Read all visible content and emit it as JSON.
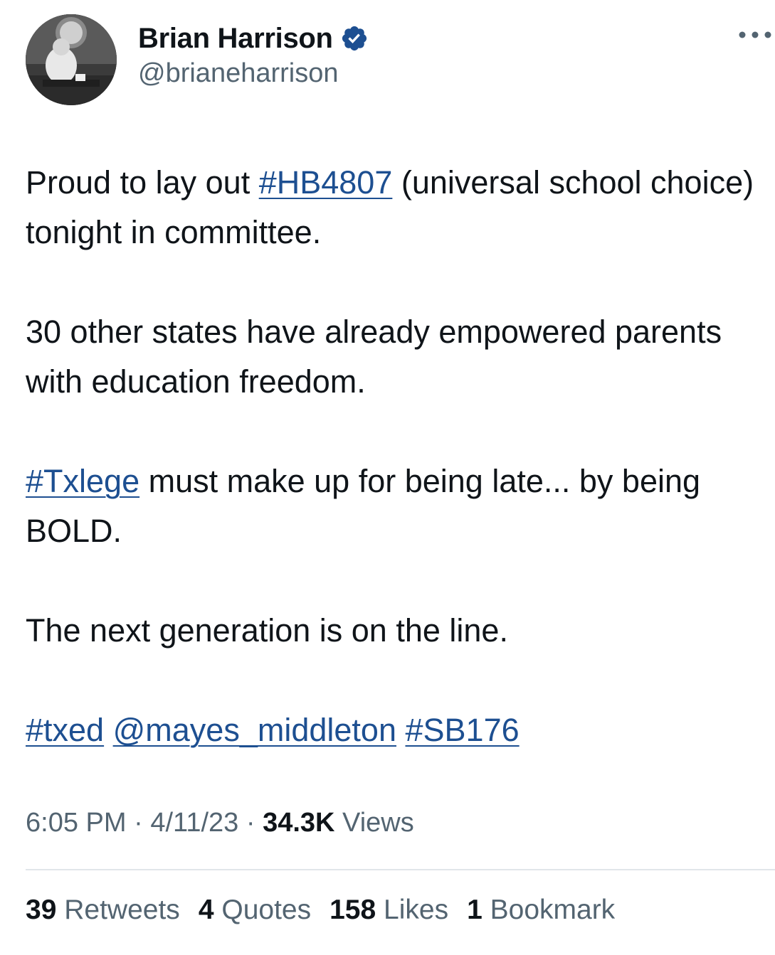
{
  "author": {
    "display_name": "Brian Harrison",
    "handle": "@brianeharrison"
  },
  "tweet": {
    "p1_hashtag": "#HB4807",
    "p1_before": "Proud to lay out ",
    "p1_after": " (universal school choice) tonight in committee.",
    "p2": "30 other states have already empowered parents with education freedom.",
    "p3_hashtag": "#Txlege",
    "p3_after": " must make up for being late... by being BOLD.",
    "p4": "The next generation is on the line.",
    "p5_tags": [
      "#txed",
      "@mayes_middleton",
      "#SB176"
    ]
  },
  "meta": {
    "time": "6:05 PM",
    "date": "4/11/23",
    "views_count": "34.3K",
    "views_label": "Views",
    "separator": "·"
  },
  "stats": {
    "retweets_count": "39",
    "retweets_label": "Retweets",
    "quotes_count": "4",
    "quotes_label": "Quotes",
    "likes_count": "158",
    "likes_label": "Likes",
    "bookmarks_count": "1",
    "bookmarks_label": "Bookmark"
  },
  "icons": {
    "verified": "verified-badge-icon",
    "more": "more-options-icon"
  },
  "colors": {
    "link": "#1d4f91",
    "verified": "#1d4f91",
    "secondary_text": "#536471",
    "primary_text": "#0f1419"
  }
}
